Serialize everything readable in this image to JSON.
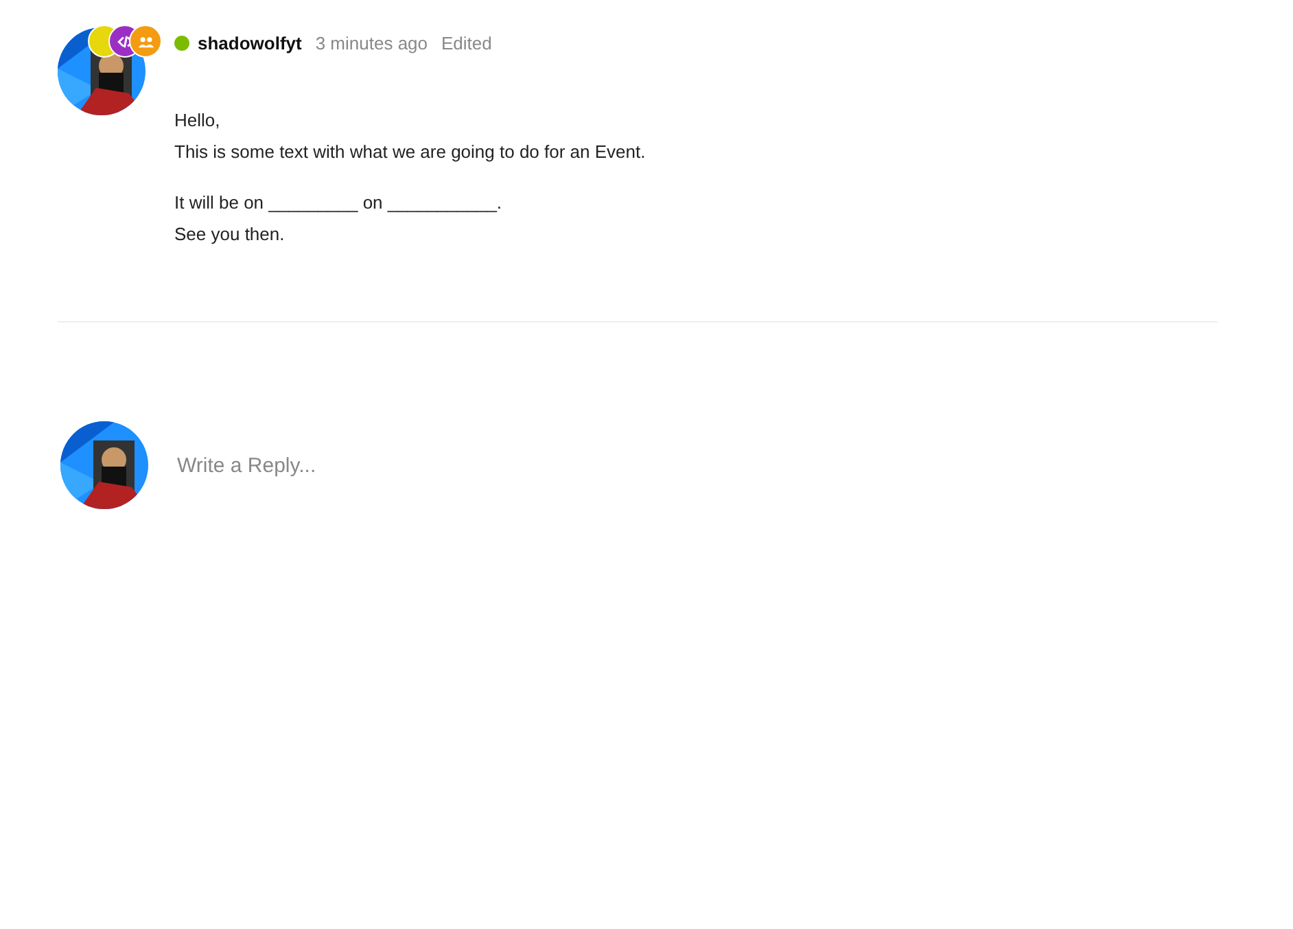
{
  "post": {
    "author": "shadowolfyt",
    "online": true,
    "time": "3 minutes ago",
    "edited": "Edited",
    "badges": [
      {
        "kind": "plain",
        "color": "#e6d80c"
      },
      {
        "kind": "code",
        "color": "#9b2fc4"
      },
      {
        "kind": "group",
        "color": "#f39c12"
      }
    ],
    "paragraphs": [
      [
        "Hello,",
        "This is some text with what we are going to do for an Event."
      ],
      [
        "It will be on _________ on ___________.",
        "See you then."
      ]
    ]
  },
  "reply": {
    "placeholder": "Write a Reply..."
  }
}
